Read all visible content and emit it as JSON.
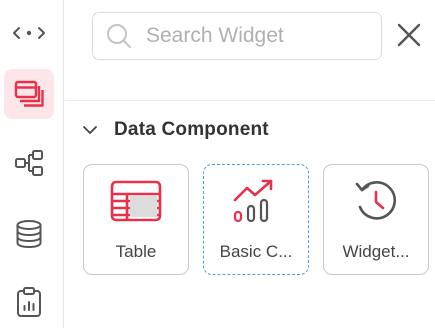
{
  "colors": {
    "accent": "#e8304a",
    "accent_bg": "#fde6ea",
    "icon_gray": "#555555",
    "selected_border": "#4a9fe0",
    "border": "#c8c8c8"
  },
  "sidebar": {
    "items": [
      {
        "icon": "expand-horizontal-icon",
        "active": false
      },
      {
        "icon": "widget-stack-icon",
        "active": true
      },
      {
        "icon": "flow-tree-icon",
        "active": false
      },
      {
        "icon": "database-icon",
        "active": false
      },
      {
        "icon": "clipboard-chart-icon",
        "active": false
      }
    ]
  },
  "search": {
    "placeholder": "Search Widget",
    "value": ""
  },
  "section": {
    "title": "Data Component",
    "expanded": true
  },
  "widgets": [
    {
      "label": "Table",
      "icon": "table-icon",
      "selected": false
    },
    {
      "label": "Basic C...",
      "icon": "trend-chart-icon",
      "selected": true
    },
    {
      "label": "Widget...",
      "icon": "history-clock-icon",
      "selected": false
    }
  ]
}
